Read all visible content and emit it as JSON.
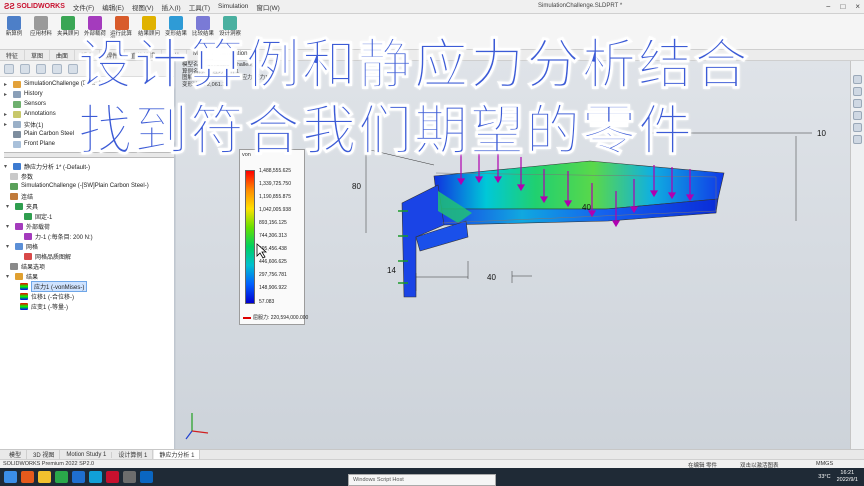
{
  "app": {
    "logo": "SOLIDWORKS",
    "menus": [
      "文件(F)",
      "编辑(E)",
      "视图(V)",
      "插入(I)",
      "工具(T)",
      "Simulation",
      "窗口(W)"
    ],
    "document_title": "SimulationChallenge.SLDPRT *",
    "window_controls": [
      "−",
      "□",
      "×"
    ]
  },
  "command_manager": {
    "buttons": [
      "新算例",
      "应用材料",
      "夹具顾问",
      "外部载荷",
      "运行此算例",
      "结果顾问",
      "变形结果",
      "比较结果",
      "设计洞察"
    ],
    "tabs": [
      "特征",
      "草图",
      "曲面",
      "钣金",
      "焊件",
      "直接编辑",
      "评估",
      "MBD",
      "Simulation"
    ]
  },
  "overlay_captions": {
    "line1": "设计算例和静应力分析结合",
    "line2": "找到符合我们期望的零件"
  },
  "model_info": {
    "line1": "模型名称: SimulationChallenge",
    "line2": "算例名称: 静应力分析 1",
    "line3": "图解类型: 静应力分析 节应力 应力1",
    "line4": "变形比例: 2,061.37"
  },
  "feature_tree": {
    "root": "SimulationChallenge (Default)",
    "items": [
      "History",
      "Sensors",
      "Annotations",
      "实体(1)",
      "Plain Carbon Steel",
      "Front Plane"
    ]
  },
  "study_tree": {
    "root": "静应力分析 1* (-Default-)",
    "items": [
      {
        "label": "参数",
        "level": 1
      },
      {
        "label": "SimulationChallenge (-[SW]Plain Carbon Steel-)",
        "level": 1
      },
      {
        "label": "连结",
        "level": 1
      },
      {
        "label": "夹具",
        "level": 1
      },
      {
        "label": "固定-1",
        "level": 2
      },
      {
        "label": "外部载荷",
        "level": 1
      },
      {
        "label": "力-1 (:每条目: 200 N:)",
        "level": 2
      },
      {
        "label": "网格",
        "level": 1
      },
      {
        "label": "网格品质图解",
        "level": 2
      },
      {
        "label": "结果选项",
        "level": 1
      },
      {
        "label": "结果",
        "level": 1
      },
      {
        "label": "应力1 (-vonMises-)",
        "level": 2,
        "selected": true
      },
      {
        "label": "位移1 (-合位移-)",
        "level": 2
      },
      {
        "label": "应变1 (-等量-)",
        "level": 2
      }
    ]
  },
  "legend": {
    "title": "von",
    "values": [
      "1,488,555.625",
      "1,339,725.750",
      "1,190,855.875",
      "1,042,005.938",
      "893,156.125",
      "744,306.313",
      "595,456.438",
      "446,606.625",
      "297,756.781",
      "148,906.922",
      "57.083"
    ],
    "yield": "屈服力: 220,594,000.000"
  },
  "dimensions": {
    "d1": "10",
    "d2": "80",
    "d3": "40",
    "d4": "14",
    "d5": "40"
  },
  "bottom_tabs": [
    "模型",
    "3D 视图",
    "Motion Study 1",
    "设计算例 1",
    "静应力分析 1"
  ],
  "status": {
    "left": "SOLIDWORKS Premium 2022 SP2.0",
    "editing": "在编辑 零件",
    "hint": "双击以激活图表",
    "units": "MMGS"
  },
  "taskbar": {
    "window_popup": "Windows Script Host",
    "temperature": "33°C",
    "time": "16:21",
    "date": "2022/9/1"
  }
}
